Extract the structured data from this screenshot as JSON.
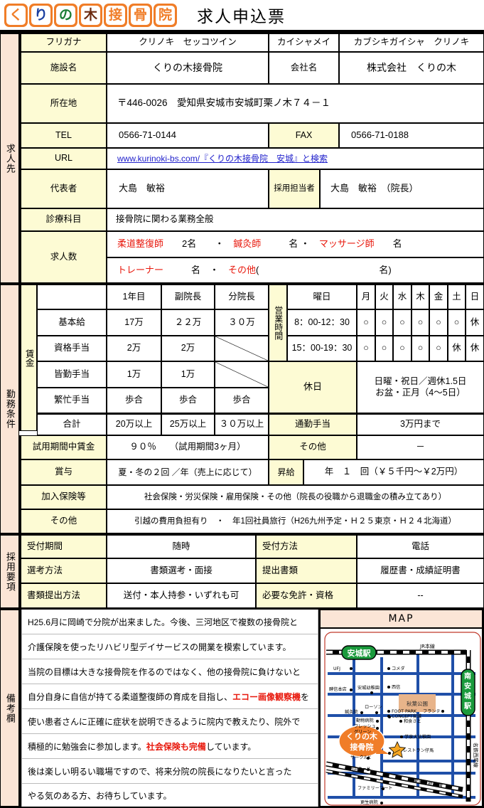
{
  "header": {
    "logo_tiles": [
      "く",
      "り",
      "の",
      "木",
      "接",
      "骨",
      "院"
    ],
    "logo_alt": "くりの木接骨院",
    "title": "求人申込票"
  },
  "sections": {
    "employer": "求人先",
    "conditions": "勤務条件",
    "wage": "賃金",
    "recruit": "採用要項",
    "remarks": "備考欄"
  },
  "employer": {
    "furigana_label": "フリガナ",
    "furigana_value": "クリノキ　セッコツイン",
    "company_furigana_label": "カイシャメイ",
    "company_furigana_value": "カブシキガイシャ　クリノキ",
    "facility_label": "施設名",
    "facility_value": "くりの木接骨院",
    "company_label": "会社名",
    "company_value": "株式会社　くりの木",
    "address_label": "所在地",
    "address_value": "〒446-0026　愛知県安城市安城町栗ノ木７４－１",
    "tel_label": "TEL",
    "tel_value": "0566-71-0144",
    "fax_label": "FAX",
    "fax_value": "0566-71-0188",
    "url_label": "URL",
    "url_value": "www.kurinoki-bs.com/『くりの木接骨院　安城』と検索",
    "rep_label": "代表者",
    "rep_value": "大島　敏裕",
    "hr_label": "採用担当者",
    "hr_value": "大島　敏裕　（院長）",
    "dept_label": "診療科目",
    "dept_value": "接骨院に関わる業務全般",
    "openings_label": "求人数",
    "openings_line1": [
      {
        "text": "柔道整復師",
        "style": "red"
      },
      {
        "text": "　　2名　　・　",
        "style": "plain"
      },
      {
        "text": "鍼灸師",
        "style": "red"
      },
      {
        "text": "　　　名 ・　",
        "style": "plain"
      },
      {
        "text": "マッサージ師",
        "style": "red"
      },
      {
        "text": "　　名",
        "style": "plain"
      }
    ],
    "openings_line2": [
      {
        "text": "トレーナー",
        "style": "red"
      },
      {
        "text": "　　　名　・　",
        "style": "plain"
      },
      {
        "text": "その他",
        "style": "red"
      },
      {
        "text": "(　　　　　　　　　　　　　名)",
        "style": "plain"
      }
    ]
  },
  "wage_table": {
    "corner": "",
    "columns": [
      "1年目",
      "副院長",
      "分院長"
    ],
    "rows": [
      {
        "label": "基本給",
        "values": [
          "17万",
          "２２万",
          "３０万"
        ],
        "diag": [
          false,
          false,
          false
        ]
      },
      {
        "label": "資格手当",
        "values": [
          "2万",
          "2万",
          ""
        ],
        "diag": [
          false,
          false,
          true
        ]
      },
      {
        "label": "皆勤手当",
        "values": [
          "1万",
          "1万",
          ""
        ],
        "diag": [
          false,
          false,
          true
        ]
      },
      {
        "label": "繁忙手当",
        "values": [
          "歩合",
          "歩合",
          "歩合"
        ],
        "diag": [
          false,
          false,
          false
        ]
      },
      {
        "label": "合計",
        "values": [
          "20万以上",
          "25万以上",
          "３０万以上"
        ],
        "diag": [
          false,
          false,
          false
        ]
      }
    ]
  },
  "hours": {
    "vertical_label": "営業時間",
    "day_header": "曜日",
    "days": [
      "月",
      "火",
      "水",
      "木",
      "金",
      "土",
      "日"
    ],
    "shifts": [
      {
        "time": "8：00-12：30",
        "marks": [
          "○",
          "○",
          "○",
          "○",
          "○",
          "○",
          "休"
        ]
      },
      {
        "time": "15：00-19：30",
        "marks": [
          "○",
          "○",
          "○",
          "○",
          "○",
          "休",
          "休"
        ]
      }
    ]
  },
  "holiday": {
    "label": "休日",
    "line1": "日曜・祝日／週休1.5日",
    "line2": "お盆・正月（4～5日）",
    "commute_label": "通勤手当",
    "commute_value": "3万円まで"
  },
  "conditions_rows": {
    "trial_label": "試用期間中賃金",
    "trial_value": "９０％　　（試用期間3ヶ月）",
    "other_label": "その他",
    "other_value": "－",
    "bonus_label": "賞与",
    "bonus_value": "夏・冬の２回 ／年（売上に応じて）",
    "raise_label": "昇給",
    "raise_value": "年　１　回（￥５千円～￥2万円）",
    "insurance_label": "加入保険等",
    "insurance_value": "社会保険・労災保険・雇用保険・その他（院長の役職から退職金の積み立てあり）",
    "misc_label": "その他",
    "misc_value": "引越の費用負担有り　・　年1回社員旅行（H26九州予定・Ｈ２５東京・Ｈ２４北海道）"
  },
  "recruit": {
    "period_label": "受付期間",
    "period_value": "随時",
    "method_label": "受付方法",
    "method_value": "電話",
    "screening_label": "選考方法",
    "screening_value": "書類選考・面接",
    "documents_label": "提出書類",
    "documents_value": "履歴書・成績証明書",
    "submit_label": "書類提出方法",
    "submit_value": "送付・本人持参・いずれも可",
    "license_label": "必要な免許・資格",
    "license_value": "--"
  },
  "remarks_lines": [
    [
      {
        "text": "H25.6月に岡崎で分院が出来ました。今後、三河地区で複数の接骨院と",
        "style": "plain"
      }
    ],
    [
      {
        "text": "介護保険を使ったリハビリ型デイサービスの開業を模索しています。",
        "style": "plain"
      }
    ],
    [
      {
        "text": "当院の目標は大きな接骨院を作るのではなく、他の接骨院に負けないと",
        "style": "plain"
      }
    ],
    [
      {
        "text": "自分自身に自信が持てる柔道整復師の育成を目指し、",
        "style": "plain"
      },
      {
        "text": "エコー画像観察機",
        "style": "redb"
      },
      {
        "text": "を",
        "style": "plain"
      }
    ],
    [
      {
        "text": "使い患者さんに正確に症状を説明できるように院内で教えたり、院外で",
        "style": "plain"
      }
    ],
    [
      {
        "text": "積極的に勉強会に参加します。",
        "style": "plain"
      },
      {
        "text": "社会保険も完備",
        "style": "redb"
      },
      {
        "text": "しています。",
        "style": "plain"
      }
    ],
    [
      {
        "text": "後は楽しい明るい職場ですので、将来分院の院長になりたいと言った",
        "style": "plain"
      }
    ],
    [
      {
        "text": "やる気のある方、お待ちしています。",
        "style": "plain"
      }
    ]
  ],
  "map": {
    "title": "MAP",
    "stations": [
      "安城駅",
      "南安城駅"
    ],
    "rail_lines": [
      "JR本線",
      "東海道新幹線",
      "名鉄西尾線"
    ],
    "clinic_label_line1": "くりの木",
    "clinic_label_line2": "接骨院",
    "park_label": "秋葉公園",
    "landmarks": [
      "UFJ",
      "コメダ",
      "酵信本店",
      "安城幼稚園",
      "西信",
      "鍼灸院",
      "ローソン",
      "FOOT PARK",
      "フランテ",
      "動物病院",
      "フレッシュ",
      "グリーン",
      "和食さと",
      "CONCEPT安城",
      "学泉大幼稚園",
      "レストラン仔馬",
      "サークルK",
      "白山ホール",
      "ファミリーマート",
      "更生病院"
    ]
  },
  "colors": {
    "label_bg": "#fdfbd4",
    "side_bg": "#fbe5d6",
    "accent_red": "#e8180c",
    "logo_orange": "#f07d28",
    "link_blue": "#2222cc",
    "map_road": "#1f4fa8",
    "map_station_green": "#1a9a3c",
    "map_clinic_orange": "#f07d28"
  }
}
